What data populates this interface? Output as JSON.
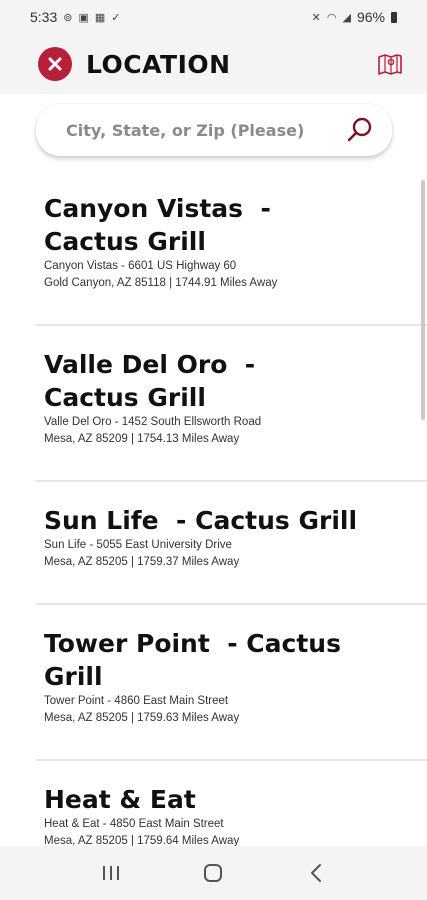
{
  "status_bar": {
    "time": "5:33",
    "left_icons": [
      "notification-icon",
      "message-icon",
      "gallery-icon",
      "check-icon"
    ],
    "battery": "96%"
  },
  "header": {
    "title": "LOCATION"
  },
  "search": {
    "placeholder": "City, State, or Zip (Please)"
  },
  "locations": [
    {
      "name": "Canyon Vistas  -\nCactus Grill",
      "address": "Canyon Vistas - 6601 US Highway 60",
      "city_distance": "Gold Canyon, AZ 85118 | 1744.91 Miles Away"
    },
    {
      "name": "Valle Del Oro  -\nCactus Grill",
      "address": "Valle Del Oro - 1452 South Ellsworth Road",
      "city_distance": "Mesa, AZ 85209 | 1754.13 Miles Away"
    },
    {
      "name": "Sun Life  - Cactus Grill",
      "address": "Sun Life - 5055 East University Drive",
      "city_distance": "Mesa, AZ 85205 | 1759.37 Miles Away"
    },
    {
      "name": "Tower Point  - Cactus\nGrill",
      "address": "Tower Point - 4860 East Main Street",
      "city_distance": "Mesa, AZ 85205 | 1759.63 Miles Away"
    },
    {
      "name": "Heat & Eat",
      "address": "Heat & Eat - 4850 East Main Street",
      "city_distance": "Mesa, AZ 85205 | 1759.64 Miles Away"
    }
  ],
  "colors": {
    "accent": "#b81f3a",
    "header_bg": "#f4f4f4"
  }
}
